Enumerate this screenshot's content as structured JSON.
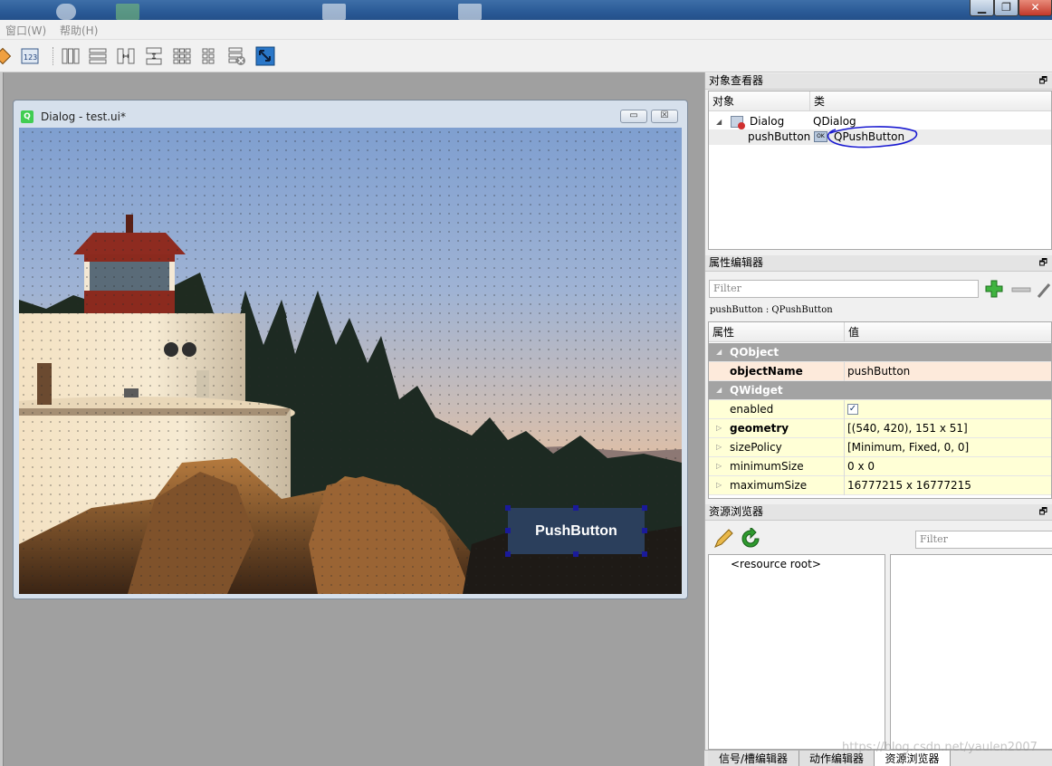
{
  "menu": {
    "window": "窗口(W)",
    "help": "帮助(H)"
  },
  "icons": {
    "min": "minimize-icon",
    "max": "restore-icon",
    "close": "close-icon",
    "tools": [
      "tab-order-icon",
      "buddy-icon",
      "layout-horizontal-icon",
      "layout-vertical-icon",
      "layout-horizontal-splitter-icon",
      "layout-vertical-splitter-icon",
      "layout-grid-icon",
      "layout-form-icon",
      "break-layout-icon",
      "adjust-size-icon"
    ]
  },
  "dialog": {
    "title": "Dialog - test.ui*",
    "button_label": "PushButton"
  },
  "object_inspector": {
    "title": "对象查看器",
    "col_object": "对象",
    "col_class": "类",
    "rows": [
      {
        "name": "Dialog",
        "class": "QDialog"
      },
      {
        "name": "pushButton",
        "class": "QPushButton"
      }
    ]
  },
  "property_editor": {
    "title": "属性编辑器",
    "filter_placeholder": "Filter",
    "class_line": "pushButton : QPushButton",
    "col_property": "属性",
    "col_value": "值",
    "rows": [
      {
        "name": "QObject",
        "value": ""
      },
      {
        "name": "objectName",
        "value": "pushButton"
      },
      {
        "name": "QWidget",
        "value": ""
      },
      {
        "name": "enabled",
        "value": "✓"
      },
      {
        "name": "geometry",
        "value": "[(540, 420), 151 x 51]"
      },
      {
        "name": "sizePolicy",
        "value": "[Minimum, Fixed, 0, 0]"
      },
      {
        "name": "minimumSize",
        "value": "0 x 0"
      },
      {
        "name": "maximumSize",
        "value": "16777215 x 16777215"
      }
    ]
  },
  "resource_browser": {
    "title": "资源浏览器",
    "filter_placeholder": "Filter",
    "root": "<resource root>"
  },
  "bottom_tabs": [
    "信号/槽编辑器",
    "动作编辑器",
    "资源浏览器"
  ],
  "watermark": "https://blog.csdn.net/yaulen2007"
}
